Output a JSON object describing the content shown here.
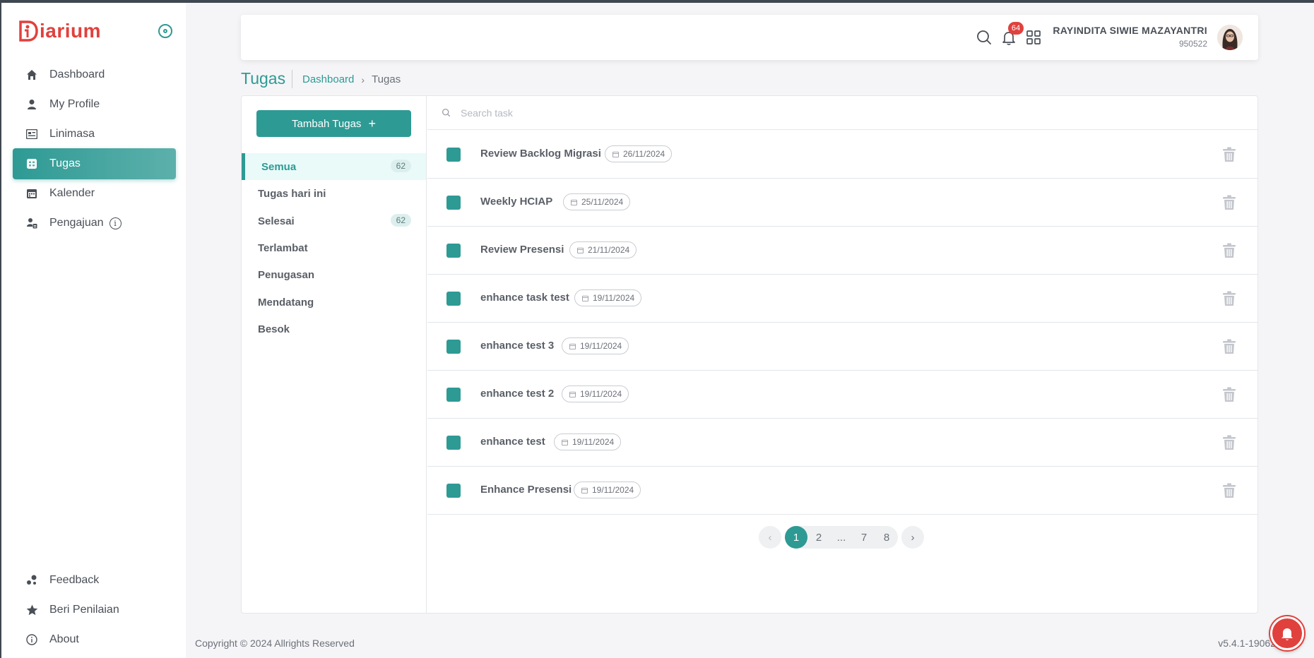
{
  "app": {
    "logo_text": "iarium",
    "brand_color": "#e0413d",
    "accent_color": "#2e9a94"
  },
  "sidebar": {
    "items": [
      {
        "label": "Dashboard",
        "icon": "home-icon"
      },
      {
        "label": "My Profile",
        "icon": "user-icon"
      },
      {
        "label": "Linimasa",
        "icon": "timeline-icon"
      },
      {
        "label": "Tugas",
        "icon": "task-icon",
        "active": true
      },
      {
        "label": "Kalender",
        "icon": "calendar-icon"
      },
      {
        "label": "Pengajuan",
        "icon": "submission-icon"
      }
    ],
    "bottom_items": [
      {
        "label": "Feedback",
        "icon": "feedback-icon"
      },
      {
        "label": "Beri Penilaian",
        "icon": "star-icon"
      },
      {
        "label": "About",
        "icon": "info-icon"
      }
    ]
  },
  "header": {
    "notification_count": "64",
    "user_name": "RAYINDITA SIWIE MAZAYANTRI",
    "user_id": "950522"
  },
  "page": {
    "title": "Tugas",
    "breadcrumb": {
      "root": "Dashboard",
      "current": "Tugas"
    }
  },
  "filters": {
    "add_button": "Tambah Tugas",
    "add_button_symbol": "+",
    "items": [
      {
        "label": "Semua",
        "count": "62",
        "active": true
      },
      {
        "label": "Tugas hari ini"
      },
      {
        "label": "Selesai",
        "count": "62"
      },
      {
        "label": "Terlambat"
      },
      {
        "label": "Penugasan"
      },
      {
        "label": "Mendatang"
      },
      {
        "label": "Besok"
      }
    ]
  },
  "search": {
    "placeholder": "Search task",
    "value": ""
  },
  "tasks": [
    {
      "title": "Review Backlog Migrasi",
      "date": "26/11/2024",
      "done": true
    },
    {
      "title": "Weekly HCIAP",
      "date": "25/11/2024",
      "done": true
    },
    {
      "title": "Review Presensi",
      "date": "21/11/2024",
      "done": true
    },
    {
      "title": "enhance task test",
      "date": "19/11/2024",
      "done": true
    },
    {
      "title": "enhance test 3",
      "date": "19/11/2024",
      "done": true
    },
    {
      "title": "enhance test 2",
      "date": "19/11/2024",
      "done": true
    },
    {
      "title": "enhance test",
      "date": "19/11/2024",
      "done": true
    },
    {
      "title": "Enhance Presensi",
      "date": "19/11/2024",
      "done": true
    }
  ],
  "pagination": {
    "prev": "‹",
    "next": "›",
    "pages": [
      "1",
      "2",
      "...",
      "7",
      "8"
    ],
    "current": "1"
  },
  "footer": {
    "copyright": "Copyright © 2024 Allrights Reserved",
    "version": "v5.4.1-19062"
  }
}
